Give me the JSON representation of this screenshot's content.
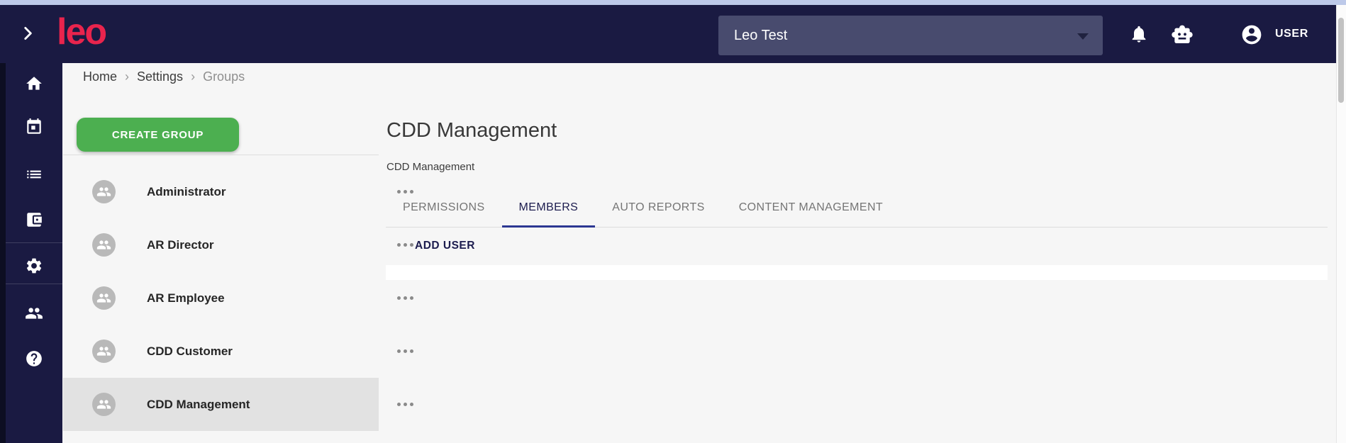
{
  "topbar": {
    "logo_text": "leo",
    "workspace_dropdown": {
      "value": "Leo Test"
    },
    "user_label": "USER",
    "icons": [
      "chevron-right-icon",
      "notifications-icon",
      "bot-icon",
      "account-icon"
    ]
  },
  "breadcrumb": {
    "separator": "›",
    "items": [
      {
        "label": "Home"
      },
      {
        "label": "Settings"
      },
      {
        "label": "Groups"
      }
    ]
  },
  "sidebar": {
    "items": [
      {
        "icon": "home-icon"
      },
      {
        "icon": "calendar-icon"
      },
      {
        "icon": "list-icon"
      },
      {
        "icon": "wallet-icon"
      },
      {
        "icon": "settings-icon"
      },
      {
        "icon": "people-icon"
      },
      {
        "icon": "help-icon"
      }
    ]
  },
  "groups_panel": {
    "create_button_label": "CREATE GROUP",
    "groups": [
      {
        "name": "Administrator",
        "selected": false
      },
      {
        "name": "AR Director",
        "selected": false
      },
      {
        "name": "AR Employee",
        "selected": false
      },
      {
        "name": "CDD Customer",
        "selected": false
      },
      {
        "name": "CDD Management",
        "selected": true
      }
    ]
  },
  "main": {
    "title": "CDD Management",
    "subtitle": "CDD Management",
    "tabs": [
      {
        "label": "PERMISSIONS",
        "active": false
      },
      {
        "label": "MEMBERS",
        "active": true
      },
      {
        "label": "AUTO REPORTS",
        "active": false
      },
      {
        "label": "CONTENT MANAGEMENT",
        "active": false
      }
    ],
    "add_user_label": "ADD USER"
  },
  "colors": {
    "top_strip": "#bdc9e9",
    "topbar_bg": "#1a1a42",
    "logo": "#e9244d",
    "accent_green": "#4caf50",
    "active_tab_underline": "#2c3792",
    "active_tab_text": "#1c1c4e",
    "selected_row_bg": "#e2e2e2",
    "content_bg": "#f6f6f6"
  }
}
